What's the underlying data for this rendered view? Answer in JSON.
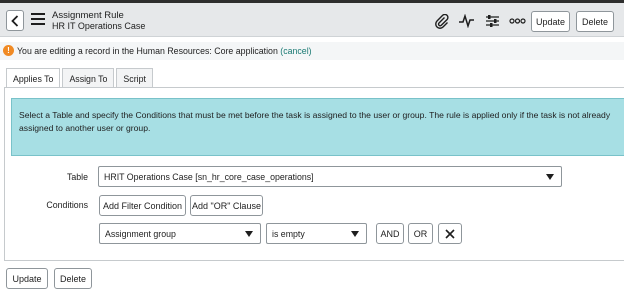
{
  "header": {
    "title": "Assignment Rule",
    "subtitle": "HR IT Operations Case",
    "update_label": "Update",
    "delete_label": "Delete"
  },
  "notice": {
    "prefix": "You are editing a record in the",
    "scope": "Human Resources: Core",
    "middle": "application",
    "link": "(cancel)"
  },
  "tabs": [
    {
      "label": "Applies To",
      "active": true
    },
    {
      "label": "Assign To",
      "active": false
    },
    {
      "label": "Script",
      "active": false
    }
  ],
  "info": {
    "text_parts": [
      "Select a ",
      "Table",
      " and specify the ",
      "Conditions",
      " that must be met before the task is assigned to the user or group. The rule is applied only if the task is not already assigned to another user or group."
    ]
  },
  "form": {
    "table_label": "Table",
    "table_value": "HRIT Operations Case [sn_hr_core_case_operations]",
    "conditions_label": "Conditions",
    "add_filter_label": "Add Filter Condition",
    "add_or_label": "Add \"OR\" Clause",
    "condition_field": "Assignment group",
    "condition_operator": "is empty",
    "and_label": "AND",
    "or_label": "OR"
  },
  "footer": {
    "update_label": "Update",
    "delete_label": "Delete"
  },
  "colors": {
    "info_bg": "#a7dfe4",
    "warning_icon": "#f08a24",
    "link": "#1a7a73"
  }
}
